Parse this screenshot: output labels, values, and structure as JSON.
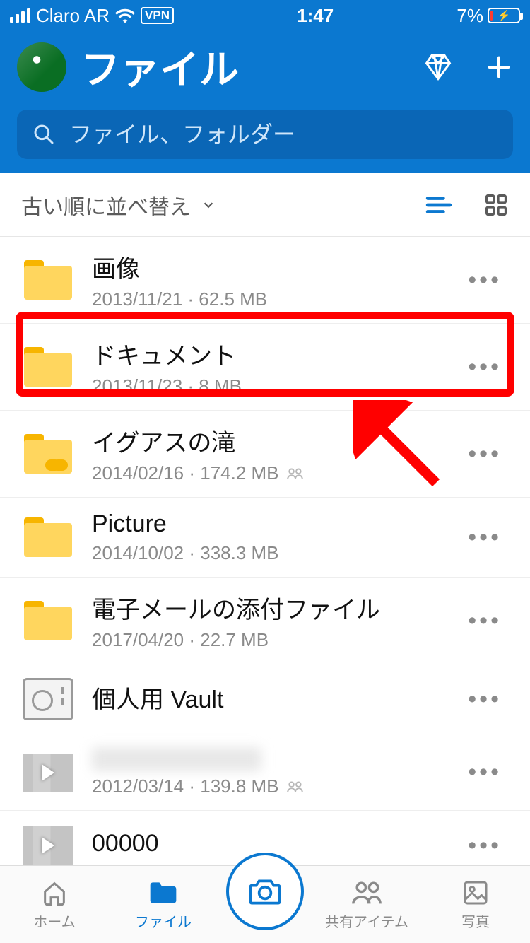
{
  "status": {
    "carrier": "Claro AR",
    "vpn": "VPN",
    "time": "1:47",
    "battery_pct": "7%"
  },
  "header": {
    "title": "ファイル"
  },
  "search": {
    "placeholder": "ファイル、フォルダー"
  },
  "sort": {
    "label": "古い順に並べ替え"
  },
  "items": [
    {
      "name": "画像",
      "date": "2013/11/21",
      "size": "62.5 MB",
      "kind": "folder",
      "shared": false
    },
    {
      "name": "ドキュメント",
      "date": "2013/11/23",
      "size": "8 MB",
      "kind": "folder",
      "shared": false,
      "highlighted": true
    },
    {
      "name": "イグアスの滝",
      "date": "2014/02/16",
      "size": "174.2 MB",
      "kind": "folder",
      "shared": true
    },
    {
      "name": "Picture",
      "date": "2014/10/02",
      "size": "338.3 MB",
      "kind": "folder",
      "shared": false
    },
    {
      "name": "電子メールの添付ファイル",
      "date": "2017/04/20",
      "size": "22.7 MB",
      "kind": "folder",
      "shared": false
    },
    {
      "name": "個人用 Vault",
      "date": "",
      "size": "",
      "kind": "vault",
      "shared": false
    },
    {
      "name": "",
      "date": "2012/03/14",
      "size": "139.8 MB",
      "kind": "video",
      "shared": true,
      "blurred": true
    },
    {
      "name": "00000",
      "date": "",
      "size": "",
      "kind": "video",
      "shared": false
    }
  ],
  "tabs": {
    "home": "ホーム",
    "files": "ファイル",
    "shared": "共有アイテム",
    "photos": "写真"
  }
}
